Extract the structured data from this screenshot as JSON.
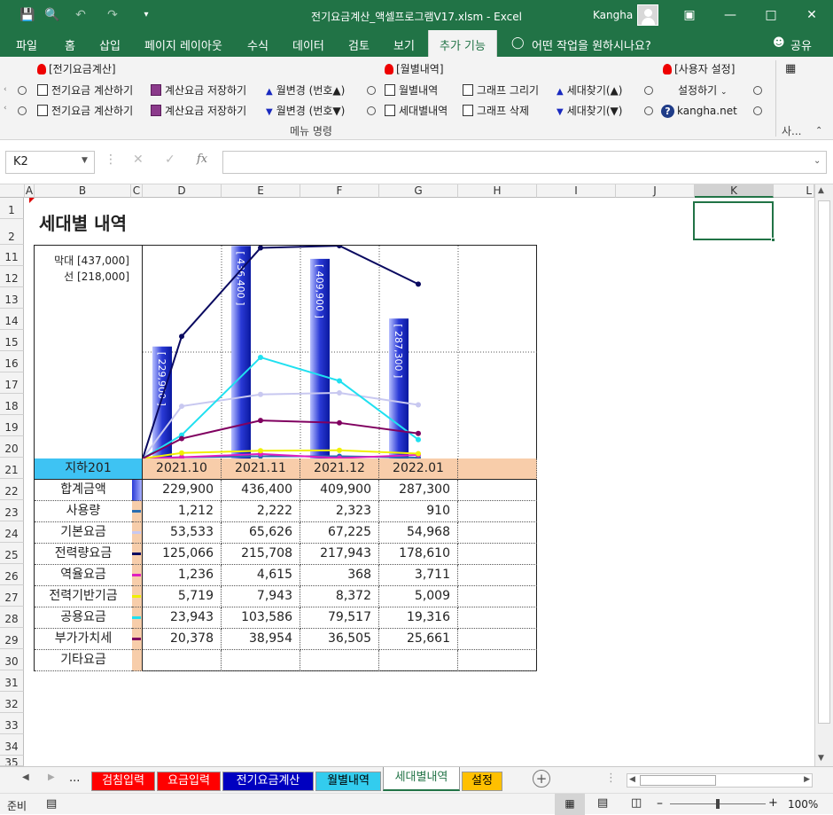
{
  "titlebar": {
    "title": "전기요금계산_액셀프로그램V17.xlsm  -  Excel",
    "user": "Kangha",
    "quick_access": [
      "save-icon",
      "print-preview-icon",
      "undo-icon",
      "redo-icon",
      "customize-icon"
    ],
    "colors": {
      "excel_green": "#217346"
    }
  },
  "tabs": [
    {
      "label": "파일"
    },
    {
      "label": "홈"
    },
    {
      "label": "삽입"
    },
    {
      "label": "페이지 레이아웃"
    },
    {
      "label": "수식"
    },
    {
      "label": "데이터"
    },
    {
      "label": "검토"
    },
    {
      "label": "보기"
    },
    {
      "label": "추가 기능"
    },
    {
      "label": "어떤 작업을 원하시나요?"
    },
    {
      "label": "공유"
    }
  ],
  "ribbon": {
    "group1_title": "[전기요금계산]",
    "group2_title": "[월별내역]",
    "group3_title": "[사용자 설정]",
    "calc_btn_1": "전기요금 계산하기",
    "calc_btn_2": "전기요금 계산하기",
    "save_btn_1": "계산요금 저장하기",
    "save_btn_2": "계산요금 저장하기",
    "month_up": "월변경 (번호▲)",
    "month_down": "월변경 (번호▼)",
    "monthly": "월별내역",
    "household": "세대별내역",
    "graph_draw": "그래프 그리기",
    "graph_delete": "그래프 삭제",
    "find_up": "세대찾기(▲)",
    "find_down": "세대찾기(▼)",
    "settings": "설정하기",
    "site": "kangha.net",
    "group_label": "메뉴 명령",
    "side_label": "사..."
  },
  "formula": {
    "namebox": "K2",
    "fx": "fx",
    "value": ""
  },
  "columns": [
    "A",
    "B",
    "C",
    "D",
    "E",
    "F",
    "G",
    "H",
    "I",
    "J",
    "K",
    "L"
  ],
  "rows": [
    "1",
    "2",
    "11",
    "12",
    "13",
    "14",
    "15",
    "16",
    "17",
    "18",
    "19",
    "20",
    "21",
    "22",
    "23",
    "24",
    "25",
    "26",
    "27",
    "28",
    "29",
    "30",
    "31",
    "32",
    "33",
    "34",
    "35"
  ],
  "sheet": {
    "title": "세대별 내역",
    "bar_scale": "막대 [437,000]",
    "line_scale": "선 [218,000]",
    "household": "지하201",
    "months": [
      "2021.10",
      "2021.11",
      "2021.12",
      "2022.01"
    ],
    "table": [
      {
        "label": "합계금액",
        "values": [
          "229,900",
          "436,400",
          "409,900",
          "287,300"
        ]
      },
      {
        "label": "사용량",
        "values": [
          "1,212",
          "2,222",
          "2,323",
          "910"
        ]
      },
      {
        "label": "기본요금",
        "values": [
          "53,533",
          "65,626",
          "67,225",
          "54,968"
        ]
      },
      {
        "label": "전력량요금",
        "values": [
          "125,066",
          "215,708",
          "217,943",
          "178,610"
        ]
      },
      {
        "label": "역율요금",
        "values": [
          "1,236",
          "4,615",
          "368",
          "3,711"
        ]
      },
      {
        "label": "전력기반기금",
        "values": [
          "5,719",
          "7,943",
          "8,372",
          "5,009"
        ]
      },
      {
        "label": "공용요금",
        "values": [
          "23,943",
          "103,586",
          "79,517",
          "19,316"
        ]
      },
      {
        "label": "부가가치세",
        "values": [
          "20,378",
          "38,954",
          "36,505",
          "25,661"
        ]
      },
      {
        "label": "기타요금",
        "values": [
          "",
          "",
          "",
          ""
        ]
      }
    ]
  },
  "chart_data": {
    "type": "bar",
    "categories": [
      "2021.10",
      "2021.11",
      "2021.12",
      "2022.01"
    ],
    "bar_max": 437000,
    "line_max": 218000,
    "bar_labels": [
      "[ 229,900 ]",
      "[ 436,400 ]",
      "[ 409,900 ]",
      "[ 287,300 ]"
    ],
    "series": [
      {
        "values": [
          229900,
          436400,
          409900,
          287300
        ],
        "color": "#2a3ad6"
      },
      {
        "values": [
          1212,
          2222,
          2323,
          910
        ],
        "color": "#2a6db0"
      },
      {
        "values": [
          53533,
          65626,
          67225,
          54968
        ],
        "color": "#c8c8f0"
      },
      {
        "values": [
          125066,
          215708,
          217943,
          178610
        ],
        "color": "#0a0a60"
      },
      {
        "values": [
          1236,
          4615,
          368,
          3711
        ],
        "color": "#e020c0"
      },
      {
        "values": [
          5719,
          7943,
          8372,
          5009
        ],
        "color": "#f0f000"
      },
      {
        "values": [
          23943,
          103586,
          79517,
          19316
        ],
        "color": "#20e0f0"
      },
      {
        "values": [
          20378,
          38954,
          36505,
          25661
        ],
        "color": "#800060"
      }
    ]
  },
  "sheet_tabs": [
    {
      "label": "검침입력",
      "bg": "#ff0000",
      "fg": "#ffffff"
    },
    {
      "label": "요금입력",
      "bg": "#ff0000",
      "fg": "#ffffff"
    },
    {
      "label": "전기요금계산",
      "bg": "#0000c0",
      "fg": "#ffffff"
    },
    {
      "label": "월별내역",
      "bg": "#33ccee",
      "fg": "#000000"
    },
    {
      "label": "세대별내역",
      "bg": "#ffffff",
      "fg": "#217346"
    },
    {
      "label": "설정",
      "bg": "#ffc000",
      "fg": "#000000"
    }
  ],
  "status": {
    "ready": "준비",
    "zoom": "100%",
    "dots": "..."
  }
}
